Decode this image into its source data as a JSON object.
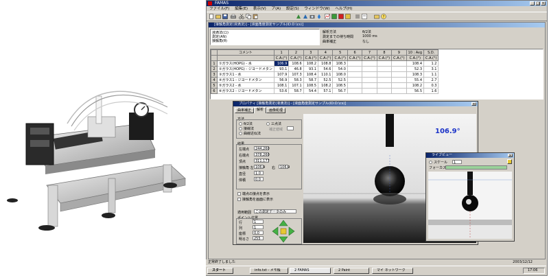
{
  "app": {
    "title": "FAMAS",
    "menu": [
      "ファイル(F)",
      "編集(E)",
      "表示(V)",
      "ア(A)",
      "設定(S)",
      "ウィンドウ(W)",
      "ヘルプ(H)"
    ]
  },
  "document": {
    "title": "[接触角測定(液滴法)] - [液面角度測定サンプル(ID:D:\\cs)]",
    "tree": [
      "液滴法(ロ)",
      "測定(AN)",
      "接触角(θ)"
    ],
    "info": [
      {
        "label": "解析方法",
        "value": "θ/2法"
      },
      {
        "label": "測定までの待ち時間",
        "value": "1000 ms"
      },
      {
        "label": "曲率補正",
        "value": "なし"
      }
    ],
    "grid": {
      "col_numbers": [
        "1",
        "2",
        "3",
        "4",
        "5",
        "6",
        "7",
        "8",
        "9",
        "10 : Avg",
        "S.D."
      ],
      "comment_header": "コメント",
      "unit": "C.A.(°)",
      "rows": [
        {
          "n": "1",
          "label": "①ガラス(HOPG) - 水",
          "values": [
            "106.9",
            "108.6",
            "108.2",
            "108.8",
            "108.3",
            "",
            "",
            "",
            "",
            "108.4",
            "1.2"
          ]
        },
        {
          "n": "2",
          "label": "②ガラス(HOPG) - ジヨードメタン",
          "values": [
            "93.1",
            "46.8",
            "93.1",
            "54.6",
            "54.0",
            "",
            "",
            "",
            "",
            "52.3",
            "3.1"
          ]
        },
        {
          "n": "3",
          "label": "③ガラス1 - 水",
          "values": [
            "107.9",
            "107.3",
            "108.4",
            "110.1",
            "108.0",
            "",
            "",
            "",
            "",
            "108.3",
            "1.1"
          ]
        },
        {
          "n": "4",
          "label": "④ガラス1 - ジヨードメタン",
          "values": [
            "56.9",
            "58.3",
            "58.7",
            "52.5",
            "52.5",
            "",
            "",
            "",
            "",
            "55.4",
            "2.7"
          ]
        },
        {
          "n": "5",
          "label": "⑤ガラス2 - 水",
          "values": [
            "108.1",
            "107.1",
            "108.5",
            "108.2",
            "108.5",
            "",
            "",
            "",
            "",
            "108.2",
            "0.3"
          ]
        },
        {
          "n": "6",
          "label": "⑥ガラス2 - ジヨードメタン",
          "values": [
            "53.6",
            "58.7",
            "54.4",
            "57.1",
            "56.7",
            "",
            "",
            "",
            "",
            "56.5",
            "1.6"
          ]
        }
      ]
    }
  },
  "dialog": {
    "title": "プロパティ [接触角測定(液滴法)] - [液面角度測定サンプル(ID:D:\\cs)]",
    "tabs": [
      "曲率補正",
      "解析",
      "画像処理"
    ],
    "method_group": "方法",
    "methods": [
      "θ/2法",
      "接線法",
      "曲線近似法",
      "三点法"
    ],
    "range_label": "補正値域",
    "result_group": "結果",
    "result_fields": [
      {
        "label": "左端点",
        "value": "244,260"
      },
      {
        "label": "右端点",
        "value": "378,260"
      },
      {
        "label": "頂点",
        "value": "311,177"
      },
      {
        "label": "接触角 左",
        "value": "106.9"
      },
      {
        "label": "直径",
        "value": "1.0"
      },
      {
        "label": "体積",
        "value": "0.0"
      }
    ],
    "right_angle_label": "右",
    "right_angle_value": "106.9",
    "checks": [
      "端点の接点を表示",
      "接触角を画面に表示"
    ],
    "apply_label": "適用範囲",
    "apply_value": "この測定データのみ",
    "point_group": "ポイント位置",
    "point_fields": [
      {
        "label": "行",
        "value": "1"
      },
      {
        "label": "列",
        "value": "1"
      },
      {
        "label": "座標",
        "value": "0,0"
      },
      {
        "label": "明るさ",
        "value": "255"
      }
    ],
    "angle_display": "106.9°"
  },
  "liveview": {
    "title": "ライブビュー",
    "scale_label": "スケール",
    "scale_value": "1",
    "focus_label": "フォーカス"
  },
  "status": {
    "text": "正常終了しました",
    "date": "2003/12/12"
  },
  "taskbar": {
    "start": "スタート",
    "tasks": [
      "info.txt - メモ帳",
      "2 FAMAS",
      "2 Paint",
      "マイ ネットワーク"
    ],
    "clock": "17:06"
  },
  "colors": {
    "titlebar": "#0a246a",
    "angle_text": "#1a32c8",
    "selected_cell": "#0a246a",
    "nav_green": "#44b044",
    "nav_center": "#e6c832"
  }
}
